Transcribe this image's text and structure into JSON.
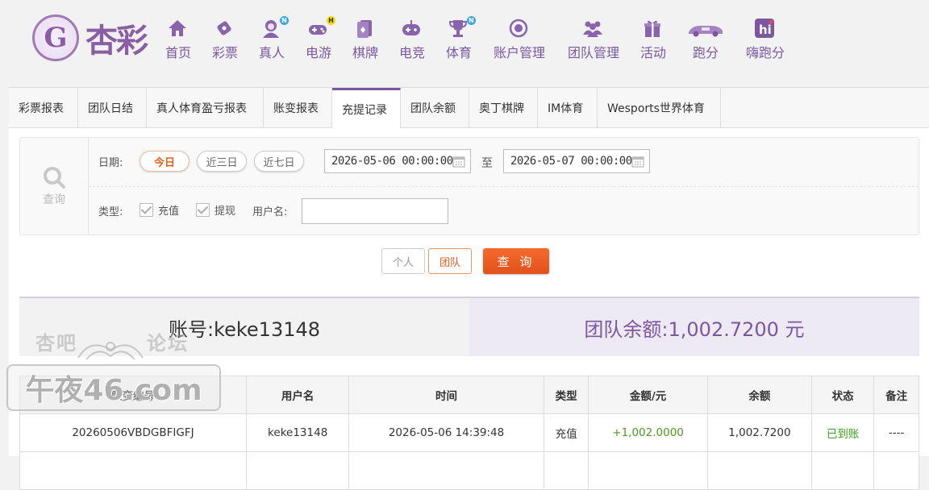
{
  "brand": {
    "mark": "G",
    "name": "杏彩"
  },
  "colors": {
    "accent": "#7b57a0",
    "primary_button": "#e85d1a",
    "success": "#3aa21e",
    "amount_positive": "#4a9a1e"
  },
  "nav": [
    {
      "label": "首页",
      "icon": "home-icon"
    },
    {
      "label": "彩票",
      "icon": "lottery-icon"
    },
    {
      "label": "真人",
      "icon": "live-dealer-icon",
      "badge": "N"
    },
    {
      "label": "电游",
      "icon": "gamepad-icon",
      "badge": "H"
    },
    {
      "label": "棋牌",
      "icon": "cards-icon"
    },
    {
      "label": "电竞",
      "icon": "esports-controller-icon"
    },
    {
      "label": "体育",
      "icon": "trophy-icon",
      "badge": "N"
    },
    {
      "label": "账户管理",
      "icon": "account-icon"
    },
    {
      "label": "团队管理",
      "icon": "team-icon"
    },
    {
      "label": "活动",
      "icon": "gift-icon"
    },
    {
      "label": "跑分",
      "icon": "racecar-icon"
    },
    {
      "label": "嗨跑分",
      "icon": "hi-app-icon"
    }
  ],
  "tabs": [
    "彩票报表",
    "团队日结",
    "真人体育盈亏报表",
    "账变报表",
    "充提记录",
    "团队余额",
    "奥丁棋牌",
    "IM体育",
    "Wesports世界体育"
  ],
  "active_tab": "充提记录",
  "query": {
    "side_label": "查询",
    "date_label": "日期:",
    "quick_ranges": [
      "今日",
      "近三日",
      "近七日"
    ],
    "active_range": "今日",
    "start": "2026-05-06 00:00:00",
    "to_label": "至",
    "end": "2026-05-07 00:00:00",
    "type_label": "类型:",
    "types": [
      "充值",
      "提现"
    ],
    "username_label": "用户名:",
    "username_value": "",
    "scope": [
      "个人",
      "团队"
    ],
    "active_scope": "团队",
    "submit": "查 询"
  },
  "summary": {
    "account": "账号:keke13148",
    "team_balance": "团队余额:1,002.7200 元"
  },
  "table": {
    "headers": [
      "账变编号",
      "用户名",
      "时间",
      "类型",
      "金额/元",
      "余额",
      "状态",
      "备注"
    ],
    "rows": [
      [
        "20260506VBDGBFIGFJ",
        "keke13148",
        "2026-05-06 14:39:48",
        "充值",
        "+1,002.0000",
        "1,002.7200",
        "已到账",
        "----"
      ]
    ]
  },
  "watermark": {
    "top_left": "杏吧",
    "top_right": "论坛",
    "main": "午夜46.com"
  }
}
